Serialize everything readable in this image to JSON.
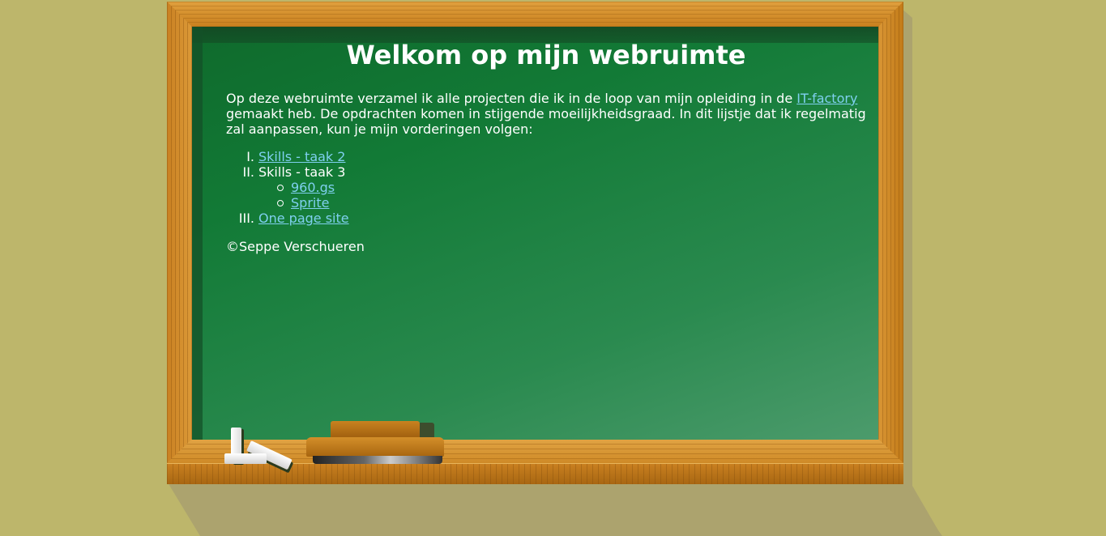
{
  "page": {
    "title": "Welkom op mijn webruimte",
    "intro_text": "Op deze webruimte verzamel ik alle projecten die ik in de loop van mijn opleiding in de ",
    "intro_link": "IT-factory",
    "intro_text_after": " gemaakt heb. De opdrachten komen in stijgende moeilijkheidsgraad. In dit lijstje dat ik regelmatig zal aanpassen, kun je mijn vorderingen volgen:"
  },
  "projects": [
    {
      "numeral": "I.",
      "label": "Skills - taak 2",
      "is_link": true
    },
    {
      "numeral": "II.",
      "label": "Skills - taak 3",
      "is_link": false,
      "children": [
        {
          "label": "960.gs"
        },
        {
          "label": "Sprite"
        }
      ]
    },
    {
      "numeral": "III.",
      "label": "One page site",
      "is_link": true
    }
  ],
  "footer": {
    "copyright": "©Seppe Verschueren"
  },
  "colors": {
    "wall": "#bdb66b",
    "board": "#127a36",
    "link": "#7fd0ef",
    "frame": "#c98020"
  }
}
